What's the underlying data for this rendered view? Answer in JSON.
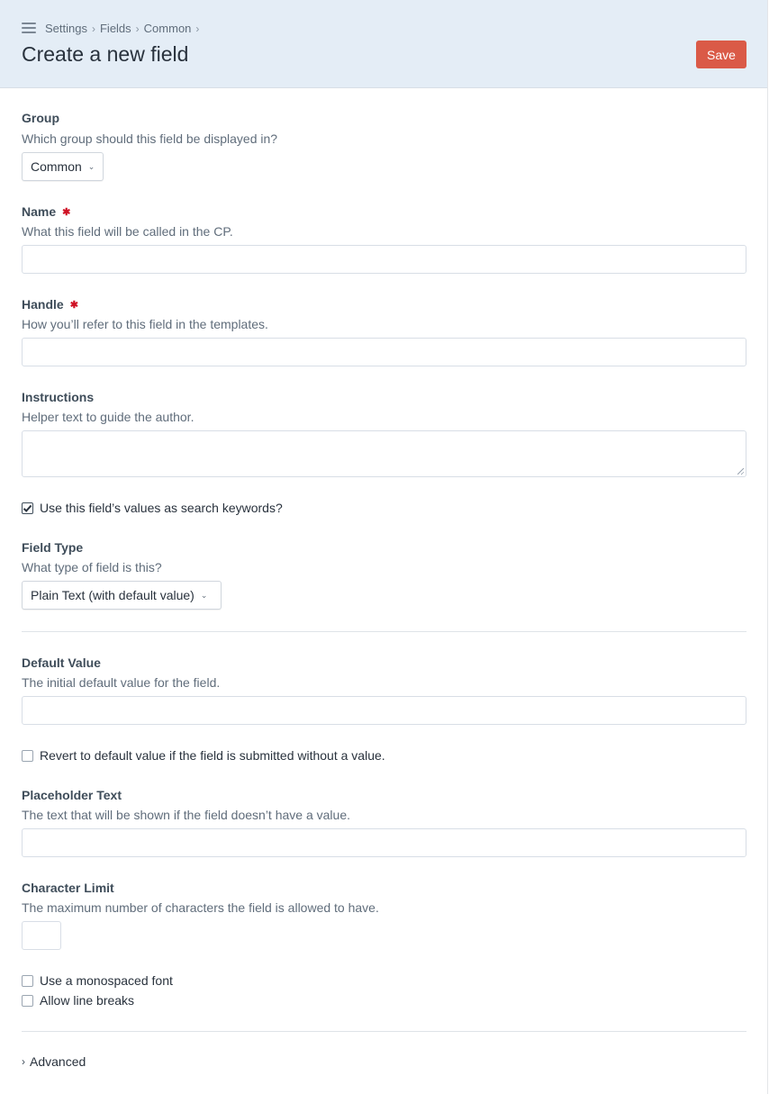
{
  "header": {
    "breadcrumbs": [
      "Settings",
      "Fields",
      "Common"
    ],
    "title": "Create a new field",
    "save_label": "Save"
  },
  "form": {
    "group": {
      "label": "Group",
      "hint": "Which group should this field be displayed in?",
      "selected": "Common"
    },
    "name": {
      "label": "Name",
      "hint": "What this field will be called in the CP.",
      "required": true,
      "value": ""
    },
    "handle": {
      "label": "Handle",
      "hint": "How you’ll refer to this field in the templates.",
      "required": true,
      "value": ""
    },
    "instructions": {
      "label": "Instructions",
      "hint": "Helper text to guide the author.",
      "value": ""
    },
    "search_keywords": {
      "label": "Use this field’s values as search keywords?",
      "checked": true
    },
    "field_type": {
      "label": "Field Type",
      "hint": "What type of field is this?",
      "selected": "Plain Text (with default value)"
    },
    "default_value": {
      "label": "Default Value",
      "hint": "The initial default value for the field.",
      "value": ""
    },
    "revert_default": {
      "label": "Revert to default value if the field is submitted without a value.",
      "checked": false
    },
    "placeholder": {
      "label": "Placeholder Text",
      "hint": "The text that will be shown if the field doesn’t have a value.",
      "value": ""
    },
    "char_limit": {
      "label": "Character Limit",
      "hint": "The maximum number of characters the field is allowed to have.",
      "value": ""
    },
    "monospace": {
      "label": "Use a monospaced font",
      "checked": false
    },
    "line_breaks": {
      "label": "Allow line breaks",
      "checked": false
    },
    "advanced_label": "Advanced"
  },
  "colors": {
    "header_bg": "#e4edf6",
    "save_bg": "#da5a47",
    "required": "#cf1124"
  },
  "icons": {
    "menu": "hamburger-icon",
    "breadcrumb_sep": "chevron-right-icon",
    "select_arrow": "chevron-down-icon",
    "advanced": "chevron-right-icon"
  }
}
